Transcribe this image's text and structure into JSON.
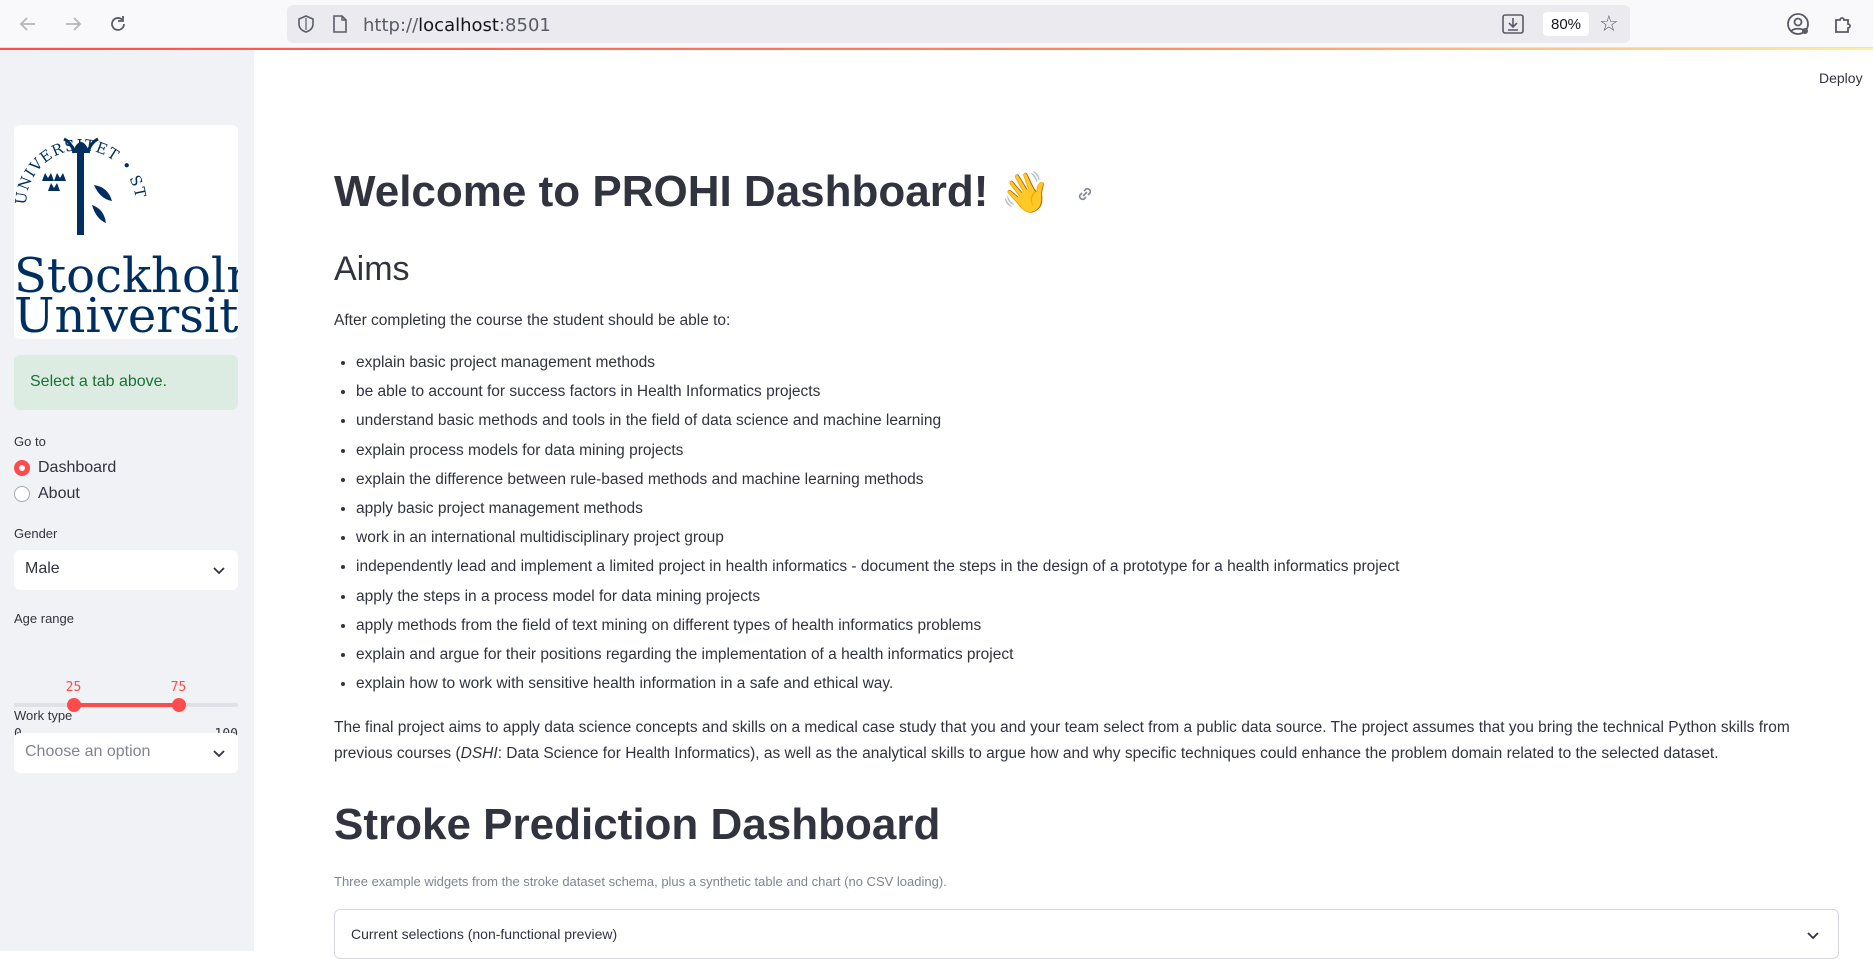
{
  "browser": {
    "url_prefix": "http://",
    "url_host": "localhost",
    "url_port": ":8501",
    "zoom": "80%"
  },
  "app": {
    "deploy_label": "Deploy"
  },
  "sidebar": {
    "logo_seal_text": "UNIVERSITET • STOCKHOLMS •",
    "logo_line1": "Stockholm",
    "logo_line2": "University",
    "info": "Select a tab above.",
    "goto_label": "Go to",
    "nav_options": [
      "Dashboard",
      "About"
    ],
    "nav_selected": "Dashboard",
    "gender_label": "Gender",
    "gender_value": "Male",
    "age_label": "Age range",
    "age_min": "0",
    "age_max": "100",
    "age_low": "25",
    "age_high": "75",
    "age_low_value": 25,
    "age_high_value": 75,
    "work_label": "Work type",
    "work_placeholder": "Choose an option"
  },
  "main": {
    "title": "Welcome to PROHI Dashboard!",
    "title_emoji": "👋",
    "aims_heading": "Aims",
    "intro": "After completing the course the student should be able to:",
    "aims": [
      "explain basic project management methods",
      "be able to account for success factors in Health Informatics projects",
      "understand basic methods and tools in the field of data science and machine learning",
      "explain process models for data mining projects",
      "explain the difference between rule-based methods and machine learning methods",
      "apply basic project management methods",
      "work in an international multidisciplinary project group",
      "independently lead and implement a limited project in health informatics - document the steps in the design of a prototype for a health informatics project",
      "apply the steps in a process model for data mining projects",
      "apply methods from the field of text mining on different types of health informatics problems",
      "explain and argue for their positions regarding the implementation of a health informatics project",
      "explain how to work with sensitive health information in a safe and ethical way."
    ],
    "para_part1": "The final project aims to apply data science concepts and skills on a medical case study that you and your team select from a public data source. The project assumes that you bring the technical Python skills from previous courses (",
    "para_italic": "DSHI",
    "para_part2": ": Data Science for Health Informatics), as well as the analytical skills to argue how and why specific techniques could enhance the problem domain related to the selected dataset.",
    "stroke_heading": "Stroke Prediction Dashboard",
    "caption": "Three example widgets from the stroke dataset schema, plus a synthetic table and chart (no CSV loading).",
    "expander_label": "Current selections (non-functional preview)"
  },
  "colors": {
    "accent": "#ff4b4b",
    "sidebar_bg": "#f0f2f6",
    "info_bg": "#dcece2",
    "info_text": "#177233",
    "su_navy": "#002f5f"
  }
}
